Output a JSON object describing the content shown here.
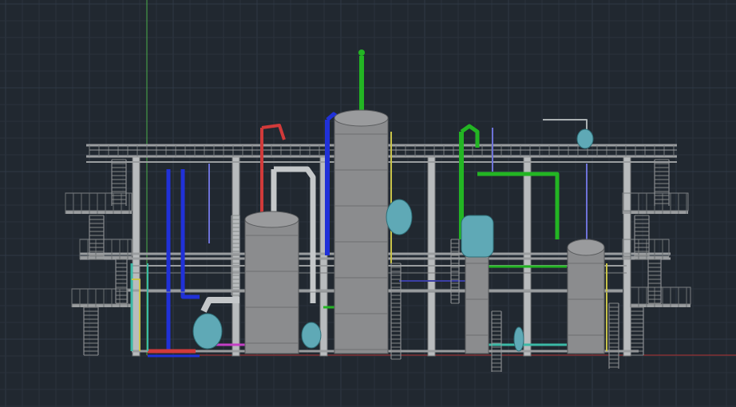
{
  "canvas": {
    "background": "#212830",
    "grid_minor_color": "#2a323c",
    "grid_major_color": "#2f3945",
    "y_axis_color": "#4cb04c",
    "x_axis_color": "#b03030"
  },
  "drawing": {
    "steel_color": "#9a9d9f",
    "vessel_color": "#8b8c8e",
    "tank_color": "#5fa9b6",
    "line_colors": {
      "blue": "#2031d8",
      "green": "#23b523",
      "red": "#d13a3a",
      "cyan": "#3bb9a6",
      "yellow": "#c9c34a",
      "magenta": "#c43fc4",
      "navy": "#3b3fa6"
    }
  }
}
